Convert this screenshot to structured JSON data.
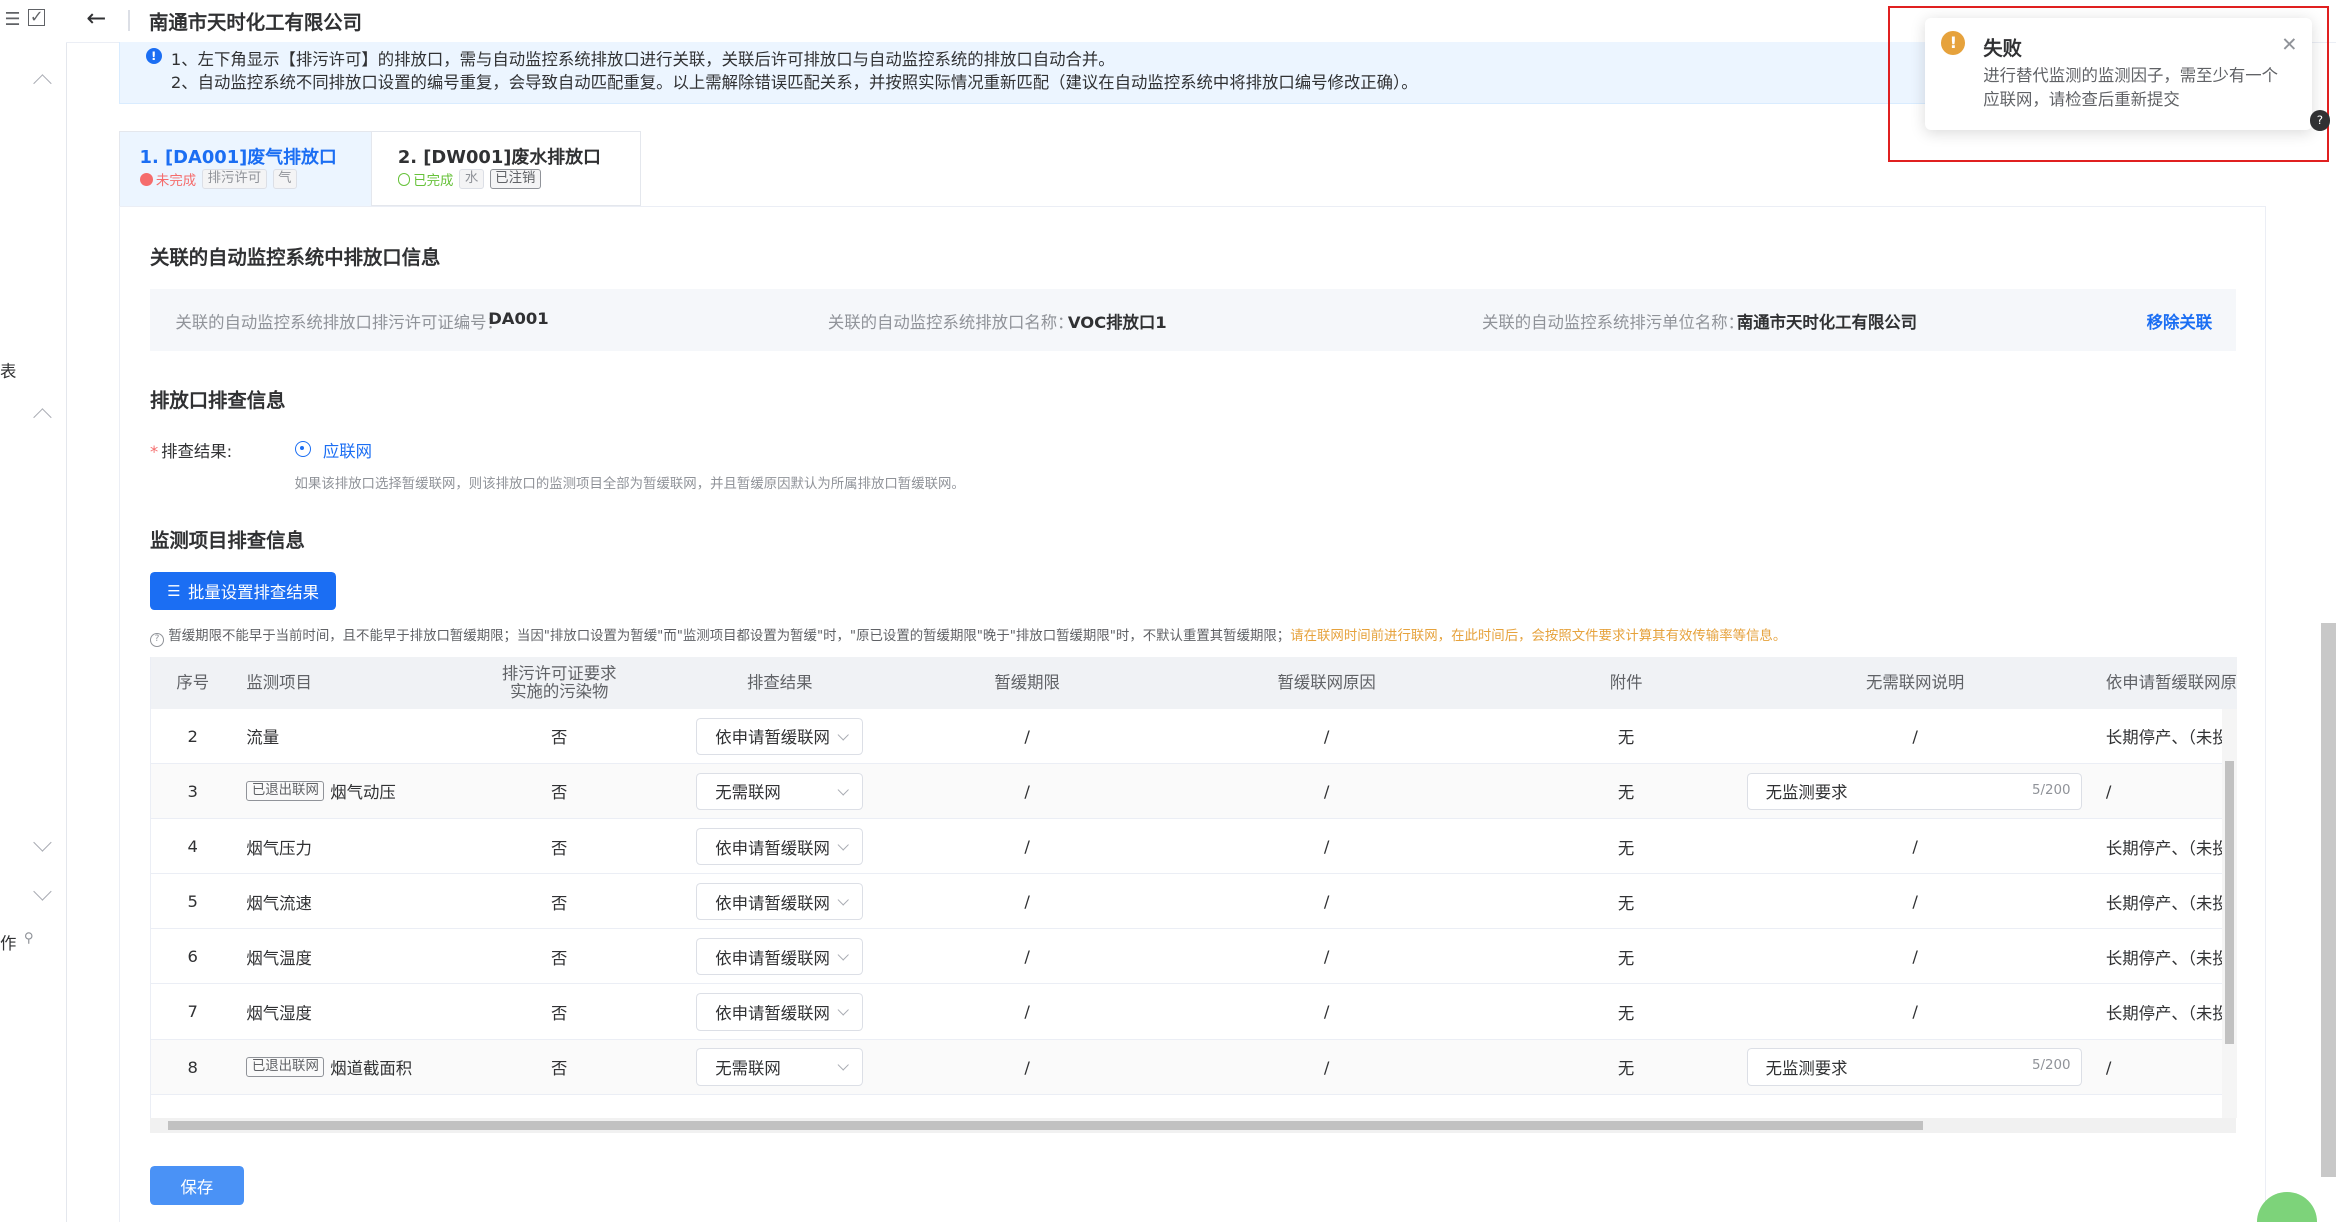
{
  "header": {
    "back_icon": "arrow-left-icon",
    "company": "南通市天时化工有限公司"
  },
  "left_sidebar": {
    "texts": [
      "表",
      "作"
    ]
  },
  "notice": {
    "line1": "1、左下角显示【排污许可】的排放口，需与自动监控系统排放口进行关联，关联后许可排放口与自动监控系统的排放口自动合并。",
    "line2": "2、自动监控系统不同排放口设置的编号重复，会导致自动匹配重复。以上需解除错误匹配关系，并按照实际情况重新匹配（建议在自动监控系统中将排放口编号修改正确）。"
  },
  "tabs": [
    {
      "title": "1. [DA001]废气排放口",
      "status": "未完成",
      "tags": [
        "排污许可",
        "气"
      ]
    },
    {
      "title": "2. [DW001]废水排放口",
      "status": "已完成",
      "tags": [
        "水",
        "已注销"
      ]
    }
  ],
  "linked_section": {
    "title": "关联的自动监控系统中排放口信息",
    "fields": [
      {
        "label": "关联的自动监控系统排放口排污许可证编号：",
        "value": "DA001"
      },
      {
        "label": "关联的自动监控系统排放口名称：",
        "value": "VOC排放口1"
      },
      {
        "label": "关联的自动监控系统排污单位名称：",
        "value": "南通市天时化工有限公司"
      }
    ],
    "unlink_label": "移除关联"
  },
  "check_section": {
    "title": "排放口排查信息",
    "result_label": "排查结果:",
    "result_value": "应联网",
    "hint": "如果该排放口选择暂缓联网，则该排放口的监测项目全部为暂缓联网，并且暂缓原因默认为所属排放口暂缓联网。"
  },
  "monitor_section": {
    "title": "监测项目排查信息",
    "batch_button": "批量设置排查结果",
    "note_normal": "暂缓期限不能早于当前时间，且不能早于排放口暂缓期限；当因\"排放口设置为暂缓\"而\"监测项目都设置为暂缓\"时，\"原已设置的暂缓期限\"晚于\"排放口暂缓期限\"时，不默认重置其暂缓期限；",
    "note_orange": "请在联网时间前进行联网，在此时间后，会按照文件要求计算其有效传输率等信息。",
    "columns": [
      "序号",
      "监测项目",
      "排污许可证要求实施的污染物",
      "排查结果",
      "暂缓期限",
      "暂缓联网原因",
      "附件",
      "无需联网说明",
      "依申请暂缓联网原因"
    ],
    "rows": [
      {
        "no": "2",
        "tag": "",
        "item": "流量",
        "permit": "否",
        "result": "依申请暂缓联网",
        "deadline": "/",
        "reason": "/",
        "attach": "无",
        "explain": "/",
        "apply_reason": "长期停产、（未投"
      },
      {
        "no": "3",
        "tag": "已退出联网",
        "item": "烟气动压",
        "permit": "否",
        "result": "无需联网",
        "deadline": "/",
        "reason": "/",
        "attach": "无",
        "explain": "无监测要求",
        "count": "5/200",
        "apply_reason": "/"
      },
      {
        "no": "4",
        "tag": "",
        "item": "烟气压力",
        "permit": "否",
        "result": "依申请暂缓联网",
        "deadline": "/",
        "reason": "/",
        "attach": "无",
        "explain": "/",
        "apply_reason": "长期停产、（未投"
      },
      {
        "no": "5",
        "tag": "",
        "item": "烟气流速",
        "permit": "否",
        "result": "依申请暂缓联网",
        "deadline": "/",
        "reason": "/",
        "attach": "无",
        "explain": "/",
        "apply_reason": "长期停产、（未投"
      },
      {
        "no": "6",
        "tag": "",
        "item": "烟气温度",
        "permit": "否",
        "result": "依申请暂缓联网",
        "deadline": "/",
        "reason": "/",
        "attach": "无",
        "explain": "/",
        "apply_reason": "长期停产、（未投"
      },
      {
        "no": "7",
        "tag": "",
        "item": "烟气湿度",
        "permit": "否",
        "result": "依申请暂缓联网",
        "deadline": "/",
        "reason": "/",
        "attach": "无",
        "explain": "/",
        "apply_reason": "长期停产、（未投"
      },
      {
        "no": "8",
        "tag": "已退出联网",
        "item": "烟道截面积",
        "permit": "否",
        "result": "无需联网",
        "deadline": "/",
        "reason": "/",
        "attach": "无",
        "explain": "无监测要求",
        "count": "5/200",
        "apply_reason": "/"
      }
    ],
    "save_button": "保存"
  },
  "toast": {
    "title": "失败",
    "message": "进行替代监测的监测因子，需至少有一个应联网，请检查后重新提交",
    "icon": "warning-icon",
    "close_icon": "close-icon"
  },
  "colors": {
    "primary": "#1b6ef3",
    "danger": "#f56c6c",
    "success": "#67c23a",
    "warning": "#e6a23c",
    "highlight_border": "#e02020"
  }
}
